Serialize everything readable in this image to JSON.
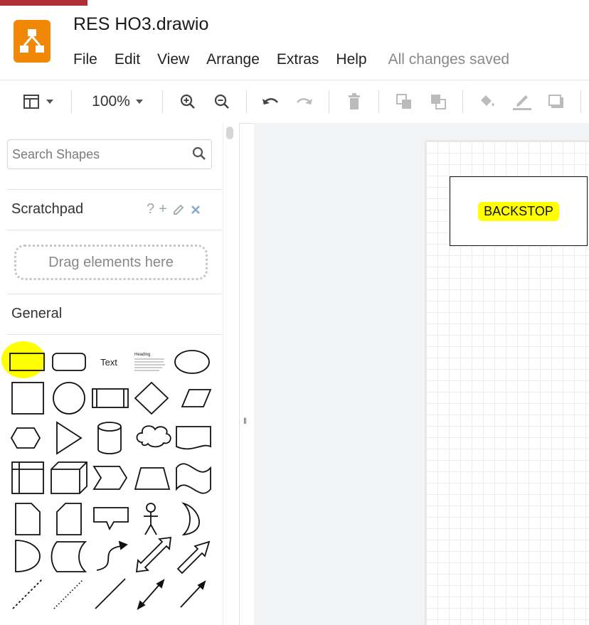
{
  "app": {
    "title": "RES HO3.drawio",
    "logo_icon": "drawio-logo-icon",
    "brand_color": "#f08705"
  },
  "menu": {
    "items": [
      "File",
      "Edit",
      "View",
      "Arrange",
      "Extras",
      "Help"
    ],
    "status": "All changes saved"
  },
  "toolbar": {
    "zoom": "100%",
    "icons": [
      "format-panel-icon",
      "zoom-in-icon",
      "zoom-out-icon",
      "undo-icon",
      "redo-icon",
      "delete-icon",
      "to-front-icon",
      "to-back-icon",
      "fill-color-icon",
      "line-color-icon",
      "shadow-icon"
    ]
  },
  "sidebar": {
    "search_placeholder": "Search Shapes",
    "scratchpad": {
      "title": "Scratchpad",
      "help": "?",
      "add": "+",
      "drop_hint": "Drag elements here"
    },
    "general": {
      "title": "General",
      "text_shape_label": "Text",
      "heading_shape_label": "Heading",
      "highlight_color": "#ffff00",
      "shapes": [
        "rectangle",
        "rounded-rectangle",
        "text",
        "textbox",
        "ellipse",
        "square",
        "circle",
        "process",
        "diamond",
        "parallelogram",
        "hexagon",
        "triangle",
        "cylinder",
        "cloud",
        "document",
        "internal-storage",
        "cube",
        "step",
        "trapezoid",
        "tape",
        "note",
        "card",
        "callout",
        "actor",
        "or",
        "and",
        "data-storage",
        "curved-arrow",
        "bidirectional-arrow",
        "arrow",
        "dashed-line",
        "dotted-line",
        "line",
        "bidirectional-connector",
        "directional-connector"
      ]
    }
  },
  "diagram": {
    "node_label": "BACKSTOP",
    "label_highlight": "#ffff00"
  }
}
